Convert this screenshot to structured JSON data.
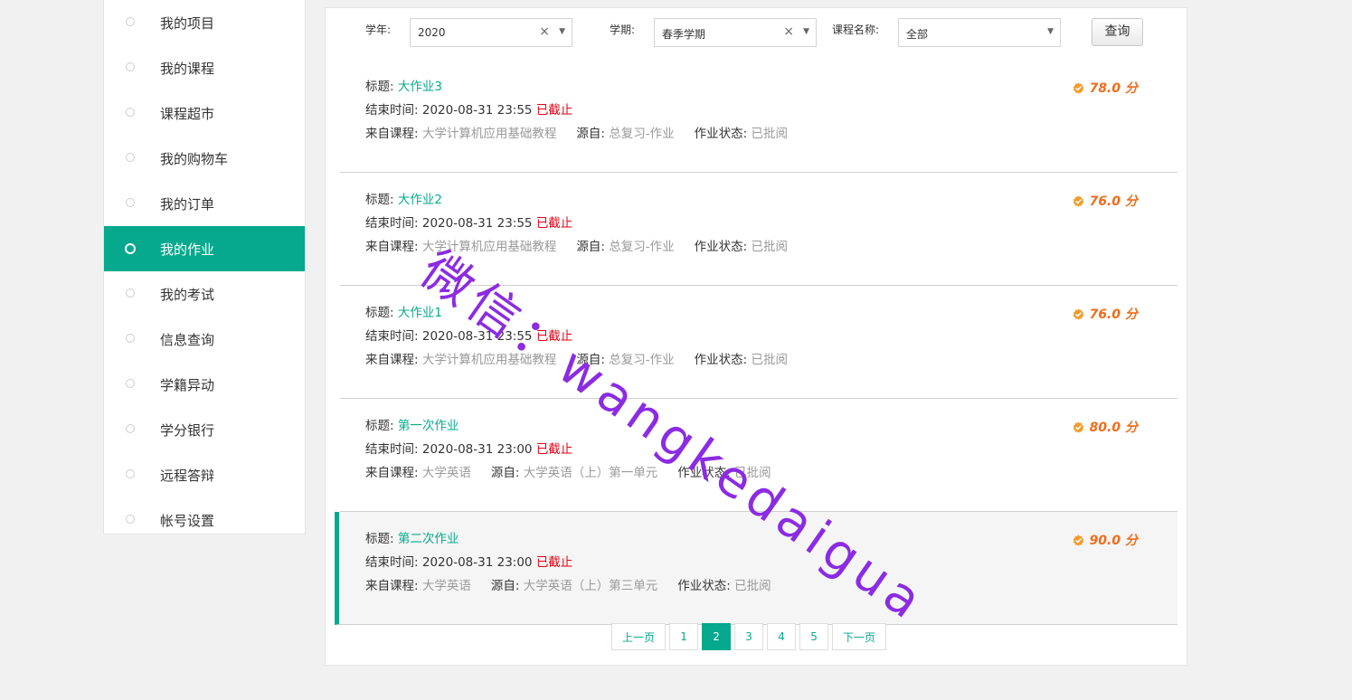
{
  "sidebar": {
    "items": [
      {
        "label": "我的项目",
        "active": false
      },
      {
        "label": "我的课程",
        "active": false
      },
      {
        "label": "课程超市",
        "active": false
      },
      {
        "label": "我的购物车",
        "active": false
      },
      {
        "label": "我的订单",
        "active": false
      },
      {
        "label": "我的作业",
        "active": true
      },
      {
        "label": "我的考试",
        "active": false
      },
      {
        "label": "信息查询",
        "active": false
      },
      {
        "label": "学籍异动",
        "active": false
      },
      {
        "label": "学分银行",
        "active": false
      },
      {
        "label": "远程答辩",
        "active": false
      },
      {
        "label": "帐号设置",
        "active": false
      }
    ]
  },
  "filter": {
    "year_label": "学年:",
    "year_value": "2020",
    "term_label": "学期:",
    "term_value": "春季学期",
    "course_label": "课程名称:",
    "course_value": "全部",
    "clear_glyph": "×",
    "arrow_glyph": "▼",
    "query_label": "查询"
  },
  "labels": {
    "title": "标题:",
    "end_time": "结束时间:",
    "from_course": "来自课程:",
    "source": "源自:",
    "status": "作业状态:"
  },
  "assignments": [
    {
      "title": "大作业3",
      "end_time": "2020-08-31 23:55",
      "deadline": "已截止",
      "course": "大学计算机应用基础教程",
      "source": "总复习-作业",
      "status": "已批阅",
      "score": "78.0 分"
    },
    {
      "title": "大作业2",
      "end_time": "2020-08-31 23:55",
      "deadline": "已截止",
      "course": "大学计算机应用基础教程",
      "source": "总复习-作业",
      "status": "已批阅",
      "score": "76.0 分"
    },
    {
      "title": "大作业1",
      "end_time": "2020-08-31 23:55",
      "deadline": "已截止",
      "course": "大学计算机应用基础教程",
      "source": "总复习-作业",
      "status": "已批阅",
      "score": "76.0 分"
    },
    {
      "title": "第一次作业",
      "end_time": "2020-08-31 23:00",
      "deadline": "已截止",
      "course": "大学英语",
      "source": "大学英语（上）第一单元",
      "status": "已批阅",
      "score": "80.0 分"
    },
    {
      "title": "第二次作业",
      "end_time": "2020-08-31 23:00",
      "deadline": "已截止",
      "course": "大学英语",
      "source": "大学英语（上）第三单元",
      "status": "已批阅",
      "score": "90.0 分"
    }
  ],
  "pagination": {
    "prev": "上一页",
    "pages": [
      "1",
      "2",
      "3",
      "4",
      "5"
    ],
    "current": "2",
    "next": "下一页"
  },
  "watermark": "微信：wangkedaigua",
  "colors": {
    "accent": "#06a98d",
    "score": "#ef6b1b",
    "expired": "#e60012",
    "watermark": "#8b2be2"
  }
}
